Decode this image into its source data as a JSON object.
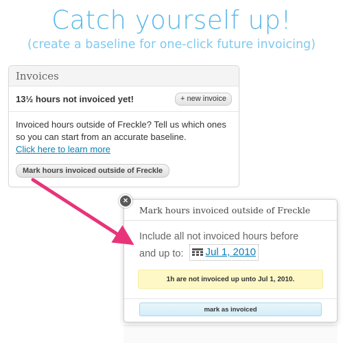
{
  "header": {
    "title": "Catch yourself up!",
    "subtitle": "(create a baseline for one-click future invoicing)"
  },
  "invoices_panel": {
    "title": "Invoices",
    "not_invoiced_text": "13½ hours not invoiced yet!",
    "new_invoice_button": "+ new invoice",
    "description": "Invoiced hours outside of Freckle? Tell us which ones so you can start from an accurate baseline.",
    "learn_more_link": "Click here to learn more",
    "mark_button": "Mark hours invoiced outside of Freckle"
  },
  "popover": {
    "title": "Mark hours invoiced outside of Freckle",
    "close_glyph": "×",
    "instruction_line1": "Include all not invoiced hours before",
    "instruction_line2": "and up to:",
    "date_value": "Jul 1, 2010",
    "calendar_icon": "calendar-icon",
    "notice": "1h are not invoiced up unto Jul 1, 2010.",
    "submit_button": "mark as invoiced"
  },
  "colors": {
    "headline": "#5ab8e6",
    "arrow": "#e8347a",
    "link": "#0a7fb6",
    "notice_bg": "#fdf8c6",
    "submit_bg": "#d3eef8"
  }
}
